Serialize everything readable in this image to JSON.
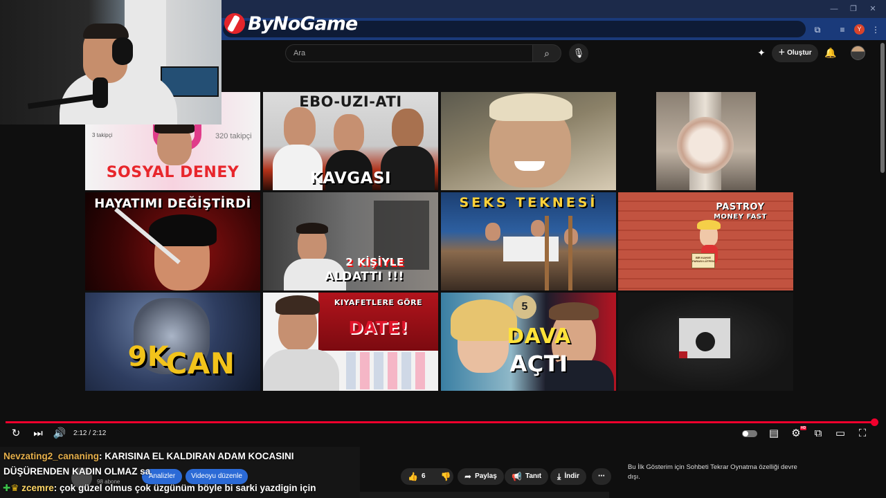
{
  "brand": {
    "logo_text": "ByNoGame"
  },
  "browser": {
    "profile_initial": "Y"
  },
  "header": {
    "search_placeholder": "Ara",
    "create_label": "Oluştur"
  },
  "thumbnails": [
    {
      "caption": "SOSYAL DENEY",
      "sub1": "3 takipçi",
      "sub2": "320 takipçi"
    },
    {
      "caption_top": "EBO-UZI-ATI",
      "caption_bottom": "KAVGASI"
    },
    {
      "caption": ""
    },
    {
      "caption": ""
    },
    {
      "caption": "HAYATIMI DEĞİŞTİRDİ"
    },
    {
      "caption_top": "2 KİŞİYLE",
      "caption_bottom": "ALDATTI !!!"
    },
    {
      "caption": "SEKS TEKNESİ"
    },
    {
      "caption_top": "PASTROY",
      "caption_bottom": "MONEY FAST",
      "sign": "BİR KAHVE PARASI LÜTFEN"
    },
    {
      "caption_top": "9K",
      "caption_bottom": "CAN"
    },
    {
      "caption_top": "KIYAFETLERE GÖRE",
      "caption_bottom": "DATE!"
    },
    {
      "caption_top": "DAVA",
      "caption_bottom": "AÇTI",
      "badge": "5"
    },
    {
      "caption": ""
    }
  ],
  "player": {
    "time": "2:12 / 2:12",
    "progress": 1.0,
    "hd_badge": "HD"
  },
  "chat": [
    {
      "user": "Nevzating2_cananing",
      "message": ": KARISINA EL KALDIRAN ADAM KOCASINI"
    },
    {
      "user": "",
      "message": "DÜŞÜRENDEN KADIN OLMAZ sa"
    },
    {
      "user": "zcemre",
      "message": ": çok güzel olmus çok üzgünüm böyle bi sarki yazdigin için"
    }
  ],
  "channel": {
    "subscribers": "98 abone",
    "analytics_label": "Analizler",
    "edit_label": "Videoyu düzenle"
  },
  "actions": {
    "like_count": "6",
    "share_label": "Paylaş",
    "promote_label": "Tanıt",
    "download_label": "İndir"
  },
  "premiere_note": "Bu İlk Gösterim için Sohbeti Tekrar Oynatma özelliği devre dışı.",
  "colors": {
    "progress": "#f0002d",
    "brand_red": "#e4252b",
    "chat_user_a": "#e7b04b",
    "button_blue": "#2b6ad6"
  }
}
